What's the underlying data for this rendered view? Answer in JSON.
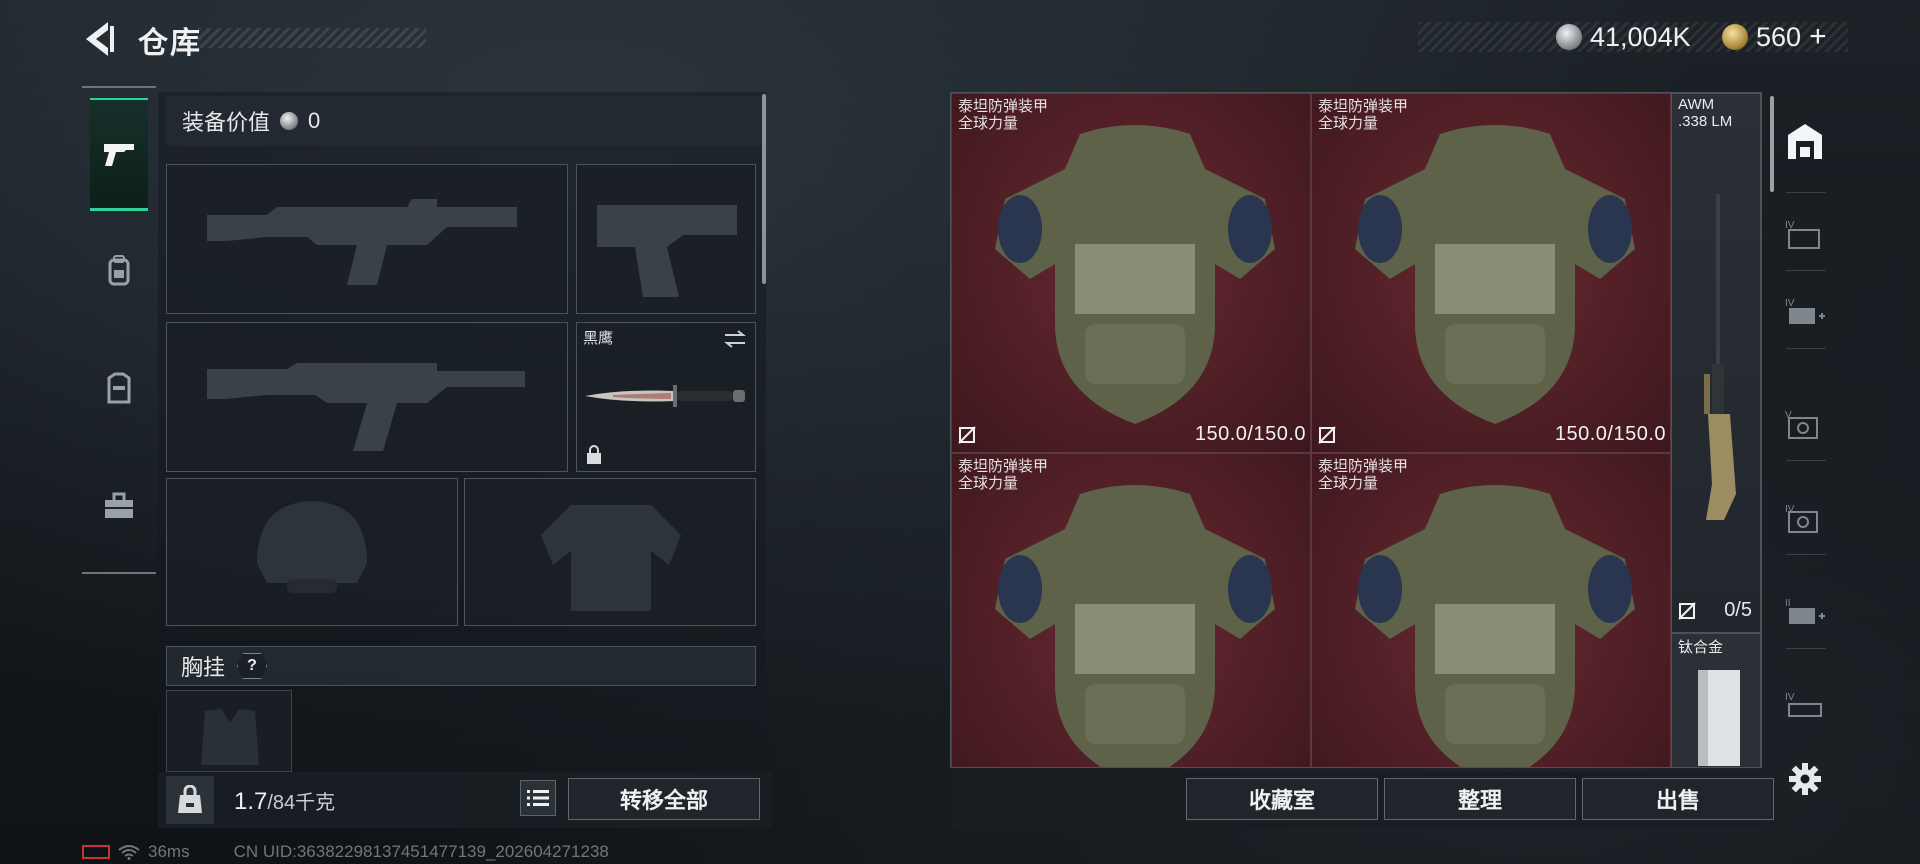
{
  "header": {
    "title": "仓库",
    "currency_primary": "41,004K",
    "currency_secondary": "560",
    "add_symbol": "+"
  },
  "loadout": {
    "value_label": "装备价值",
    "value_amount": "0",
    "knife_name": "黑鹰",
    "chest_rig_label": "胸挂",
    "chest_rig_help": "?"
  },
  "weight": {
    "current": "1.7",
    "max": "/84千克"
  },
  "buttons": {
    "transfer_all": "转移全部",
    "collection": "收藏室",
    "organize": "整理",
    "sell": "出售"
  },
  "storage": {
    "items": [
      {
        "name_line1": "泰坦防弹装甲",
        "name_line2": "全球力量",
        "durability": "150.0/150.0"
      },
      {
        "name_line1": "泰坦防弹装甲",
        "name_line2": "全球力量",
        "durability": "150.0/150.0"
      },
      {
        "name_line1": "泰坦防弹装甲",
        "name_line2": "全球力量",
        "durability": ""
      },
      {
        "name_line1": "泰坦防弹装甲",
        "name_line2": "全球力量",
        "durability": ""
      }
    ],
    "awm": {
      "name_line1": "AWM",
      "name_line2": ".338 LM",
      "count": "0/5"
    },
    "titanium": {
      "name": "钛合金"
    }
  },
  "status": {
    "ping": "36ms",
    "uid": "CN UID:36382298137451477139_202604271238"
  },
  "colors": {
    "accent": "#2fd39a",
    "armor_cell": "#5a2129",
    "panel": "#1a1f24"
  }
}
